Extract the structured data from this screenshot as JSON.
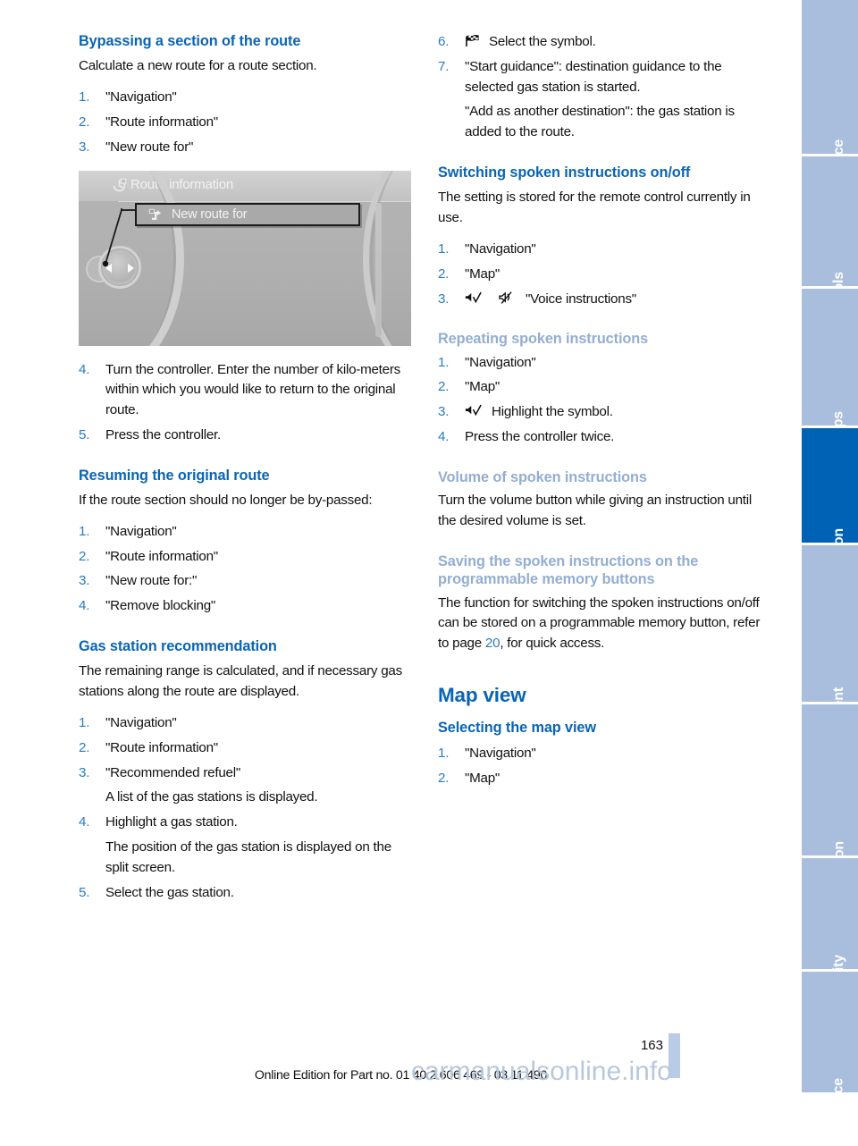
{
  "document": {
    "page_number": "163",
    "footer": "Online Edition for Part no. 01 40 2 606 469 - 03 11 490",
    "watermark": "carmanualsonline.info",
    "accent_blue": "#0a64b4",
    "step_blue": "#2b7bc4",
    "subheading_blue": "#93aed2",
    "active_tab_blue": "#0062b4",
    "tab_blue": "#a9bedd"
  },
  "left_column": {
    "section1": {
      "heading": "Bypassing a section of the route",
      "intro": "Calculate a new route for a route section.",
      "steps_before_figure": [
        "\"Navigation\"",
        "\"Route information\"",
        "\"New route for\""
      ],
      "figure": {
        "screen_title": "Route information",
        "screen_title_icon": "route-information-icon",
        "menu_item": "New route for",
        "menu_item_icon": "new-route-icon",
        "controller_icon": "idrive-controller"
      },
      "steps_after_figure": [
        {
          "number": "4.",
          "text": "Turn the controller. Enter the number of kilo-meters within which you would like to return to the original route."
        },
        {
          "number": "5.",
          "text": "Press the controller."
        }
      ]
    },
    "section2": {
      "heading": "Resuming the original route",
      "intro": "If the route section should no longer be by-passed:",
      "steps": [
        "\"Navigation\"",
        "\"Route information\"",
        "\"New route for:\"",
        "\"Remove blocking\""
      ]
    },
    "section3": {
      "heading": "Gas station recommendation",
      "intro": "The remaining range is calculated, and if necessary gas stations along the route are displayed.",
      "steps": [
        {
          "number": "1.",
          "text": "\"Navigation\"",
          "sub": ""
        },
        {
          "number": "2.",
          "text": "\"Route information\"",
          "sub": ""
        },
        {
          "number": "3.",
          "text": "\"Recommended refuel\"",
          "sub": "A list of the gas stations is displayed."
        },
        {
          "number": "4.",
          "text": "Highlight a gas station.",
          "sub": "The position of the gas station is displayed on the split screen."
        },
        {
          "number": "5.",
          "text": "Select the gas station.",
          "sub": ""
        }
      ]
    }
  },
  "right_column": {
    "continued_steps": [
      {
        "number": "6.",
        "icon": "checkered-flag-icon",
        "text": "Select the symbol.",
        "sub": ""
      },
      {
        "number": "7.",
        "icon": "",
        "text": "\"Start guidance\": destination guidance to the selected gas station is started.",
        "sub": "\"Add as another destination\": the gas station is added to the route."
      }
    ],
    "section4": {
      "heading": "Switching spoken instructions on/off",
      "intro": "The setting is stored for the remote control currently in use.",
      "steps": [
        {
          "number": "1.",
          "text": "\"Navigation\"",
          "icons": []
        },
        {
          "number": "2.",
          "text": "\"Map\"",
          "icons": []
        },
        {
          "number": "3.",
          "text": "\"Voice instructions\"",
          "icons": [
            "speaker-check-icon",
            "speaker-muted-icon"
          ]
        }
      ]
    },
    "section5": {
      "heading": "Repeating spoken instructions",
      "steps": [
        {
          "number": "1.",
          "text": "\"Navigation\"",
          "icons": []
        },
        {
          "number": "2.",
          "text": "\"Map\"",
          "icons": []
        },
        {
          "number": "3.",
          "text": "Highlight the symbol.",
          "icons": [
            "speaker-check-icon"
          ]
        },
        {
          "number": "4.",
          "text": "Press the controller twice.",
          "icons": []
        }
      ]
    },
    "section6": {
      "heading": "Volume of spoken instructions",
      "body": "Turn the volume button while giving an instruction until the desired volume is set."
    },
    "section7": {
      "heading": "Saving the spoken instructions on the programmable memory buttons",
      "body_part1": "The function for switching the spoken instructions on/off can be stored on a programmable memory button, refer to page ",
      "page_ref": "20",
      "body_part2": ", for quick access."
    },
    "section8": {
      "heading": "Map view",
      "subheading": "Selecting the map view",
      "steps": [
        "\"Navigation\"",
        "\"Map\""
      ]
    }
  },
  "sidebar": {
    "tabs": [
      {
        "label": "At a glance",
        "active": false
      },
      {
        "label": "Controls",
        "active": false
      },
      {
        "label": "Driving tips",
        "active": false
      },
      {
        "label": "Navigation",
        "active": true
      },
      {
        "label": "Entertainment",
        "active": false
      },
      {
        "label": "Communication",
        "active": false
      },
      {
        "label": "Mobility",
        "active": false
      },
      {
        "label": "Reference",
        "active": false
      }
    ]
  }
}
